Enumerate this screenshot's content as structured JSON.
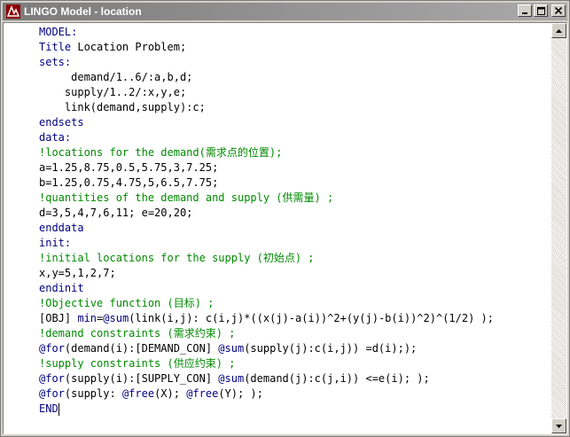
{
  "window": {
    "title": "LINGO Model - location",
    "icons": {
      "app": "lingo-app-icon",
      "minimize": "minimize-icon",
      "maximize": "maximize-icon",
      "close": "close-icon"
    }
  },
  "colors": {
    "keyword": "#00007f",
    "comment": "#008a00",
    "text": "#000000",
    "titlebar": "#7b7b7b"
  },
  "code_lines": [
    {
      "segments": [
        {
          "t": "MODEL:",
          "c": "kw"
        }
      ]
    },
    {
      "segments": [
        {
          "t": "Title",
          "c": "kw"
        },
        {
          "t": " Location Problem;",
          "c": ""
        }
      ]
    },
    {
      "segments": [
        {
          "t": "sets:",
          "c": "kw"
        }
      ]
    },
    {
      "segments": [
        {
          "t": "     demand/1..6/:a,b,d;",
          "c": ""
        }
      ]
    },
    {
      "segments": [
        {
          "t": "    supply/1..2/:x,y,e;",
          "c": ""
        }
      ]
    },
    {
      "segments": [
        {
          "t": "    link(demand,supply):c;",
          "c": ""
        }
      ]
    },
    {
      "segments": [
        {
          "t": "endsets",
          "c": "kw"
        }
      ]
    },
    {
      "segments": [
        {
          "t": "data:",
          "c": "kw"
        }
      ]
    },
    {
      "segments": [
        {
          "t": "!locations for the demand(需求点的位置);",
          "c": "cm"
        }
      ]
    },
    {
      "segments": [
        {
          "t": "a=1.25,8.75,0.5,5.75,3,7.25;",
          "c": ""
        }
      ]
    },
    {
      "segments": [
        {
          "t": "b=1.25,0.75,4.75,5,6.5,7.75;",
          "c": ""
        }
      ]
    },
    {
      "segments": [
        {
          "t": "!quantities of the demand and supply (供需量) ;",
          "c": "cm"
        }
      ]
    },
    {
      "segments": [
        {
          "t": "d=3,5,4,7,6,11; e=20,20;",
          "c": ""
        }
      ]
    },
    {
      "segments": [
        {
          "t": "enddata",
          "c": "kw"
        }
      ]
    },
    {
      "segments": [
        {
          "t": "init:",
          "c": "kw"
        }
      ]
    },
    {
      "segments": [
        {
          "t": "!initial locations for the supply (初始点) ;",
          "c": "cm"
        }
      ]
    },
    {
      "segments": [
        {
          "t": "x,y=5,1,2,7;",
          "c": ""
        }
      ]
    },
    {
      "segments": [
        {
          "t": "endinit",
          "c": "kw"
        }
      ]
    },
    {
      "segments": [
        {
          "t": "!Objective function (目标) ;",
          "c": "cm"
        }
      ]
    },
    {
      "segments": [
        {
          "t": "[OBJ] ",
          "c": ""
        },
        {
          "t": "min",
          "c": "kw"
        },
        {
          "t": "=",
          "c": ""
        },
        {
          "t": "@sum",
          "c": "kw"
        },
        {
          "t": "(link(i,j): c(i,j)*((x(j)-a(i))^2+(y(j)-b(i))^2)^(1/2) );",
          "c": ""
        }
      ]
    },
    {
      "segments": [
        {
          "t": "!demand constraints (需求约束) ;",
          "c": "cm"
        }
      ]
    },
    {
      "segments": [
        {
          "t": "@for",
          "c": "kw"
        },
        {
          "t": "(demand(i):[DEMAND_CON] ",
          "c": ""
        },
        {
          "t": "@sum",
          "c": "kw"
        },
        {
          "t": "(supply(j):c(i,j)) =d(i););",
          "c": ""
        }
      ]
    },
    {
      "segments": [
        {
          "t": "!supply constraints (供应约束) ;",
          "c": "cm"
        }
      ]
    },
    {
      "segments": [
        {
          "t": "@for",
          "c": "kw"
        },
        {
          "t": "(supply(i):[SUPPLY_CON] ",
          "c": ""
        },
        {
          "t": "@sum",
          "c": "kw"
        },
        {
          "t": "(demand(j):c(j,i)) <=e(i); );",
          "c": ""
        }
      ]
    },
    {
      "segments": [
        {
          "t": "@for",
          "c": "kw"
        },
        {
          "t": "(supply: ",
          "c": ""
        },
        {
          "t": "@free",
          "c": "kw"
        },
        {
          "t": "(X); ",
          "c": ""
        },
        {
          "t": "@free",
          "c": "kw"
        },
        {
          "t": "(Y); );",
          "c": ""
        }
      ]
    },
    {
      "segments": [
        {
          "t": "END",
          "c": "kw"
        }
      ],
      "caret": true
    }
  ]
}
